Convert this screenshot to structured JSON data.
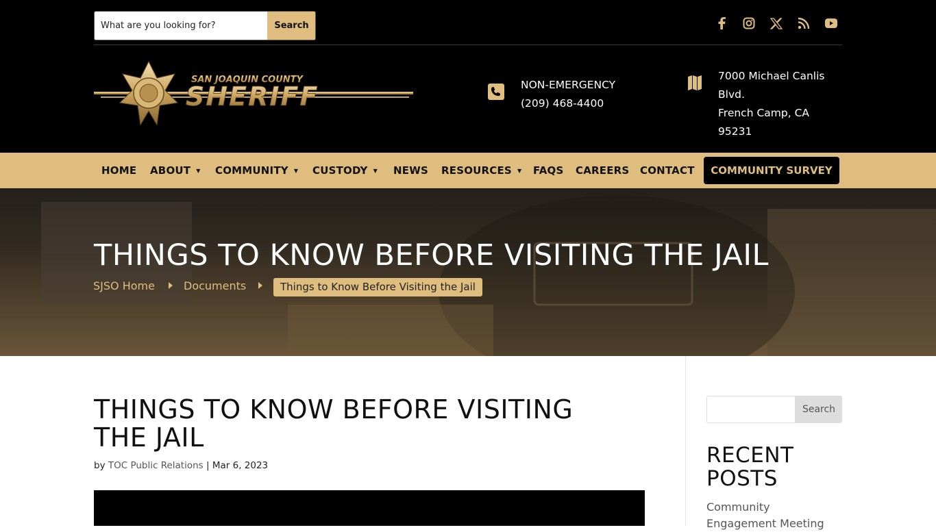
{
  "header": {
    "search": {
      "placeholder": "What are you looking for?",
      "button_label": "Search"
    },
    "social_icons": [
      "facebook-icon",
      "instagram-icon",
      "x-icon",
      "rss-icon",
      "youtube-icon"
    ],
    "logo_text": {
      "top": "SAN JOAQUIN COUNTY",
      "main": "SHERIFF"
    },
    "phone": {
      "line1": "NON-EMERGENCY",
      "line2": "(209) 468-4400"
    },
    "address": {
      "line1": "7000 Michael Canlis",
      "line2": "Blvd.",
      "line3": "French Camp, CA 95231"
    }
  },
  "nav": {
    "items": [
      {
        "label": "HOME",
        "has_dropdown": false
      },
      {
        "label": "ABOUT",
        "has_dropdown": true
      },
      {
        "label": "COMMUNITY",
        "has_dropdown": true
      },
      {
        "label": "CUSTODY",
        "has_dropdown": true
      },
      {
        "label": "NEWS",
        "has_dropdown": false
      },
      {
        "label": "RESOURCES",
        "has_dropdown": true
      },
      {
        "label": "FAQS",
        "has_dropdown": false
      },
      {
        "label": "CAREERS",
        "has_dropdown": false
      },
      {
        "label": "CONTACT",
        "has_dropdown": false
      }
    ],
    "cta_label": "COMMUNITY SURVEY"
  },
  "hero": {
    "title": "THINGS TO KNOW BEFORE VISITING THE JAIL",
    "breadcrumb": [
      "SJSO Home",
      "Documents",
      "Things to Know Before Visiting the Jail"
    ]
  },
  "post": {
    "title": "THINGS TO KNOW BEFORE VISITING THE JAIL",
    "meta_by": "by",
    "author": "TOC Public Relations",
    "separator": "|",
    "date": "Mar 6, 2023"
  },
  "sidebar": {
    "search_button": "Search",
    "recent_heading": "RECENT POSTS",
    "recent_first": "Community Engagement Meeting"
  },
  "colors": {
    "gold": "#dfbd7e",
    "black": "#000000"
  }
}
